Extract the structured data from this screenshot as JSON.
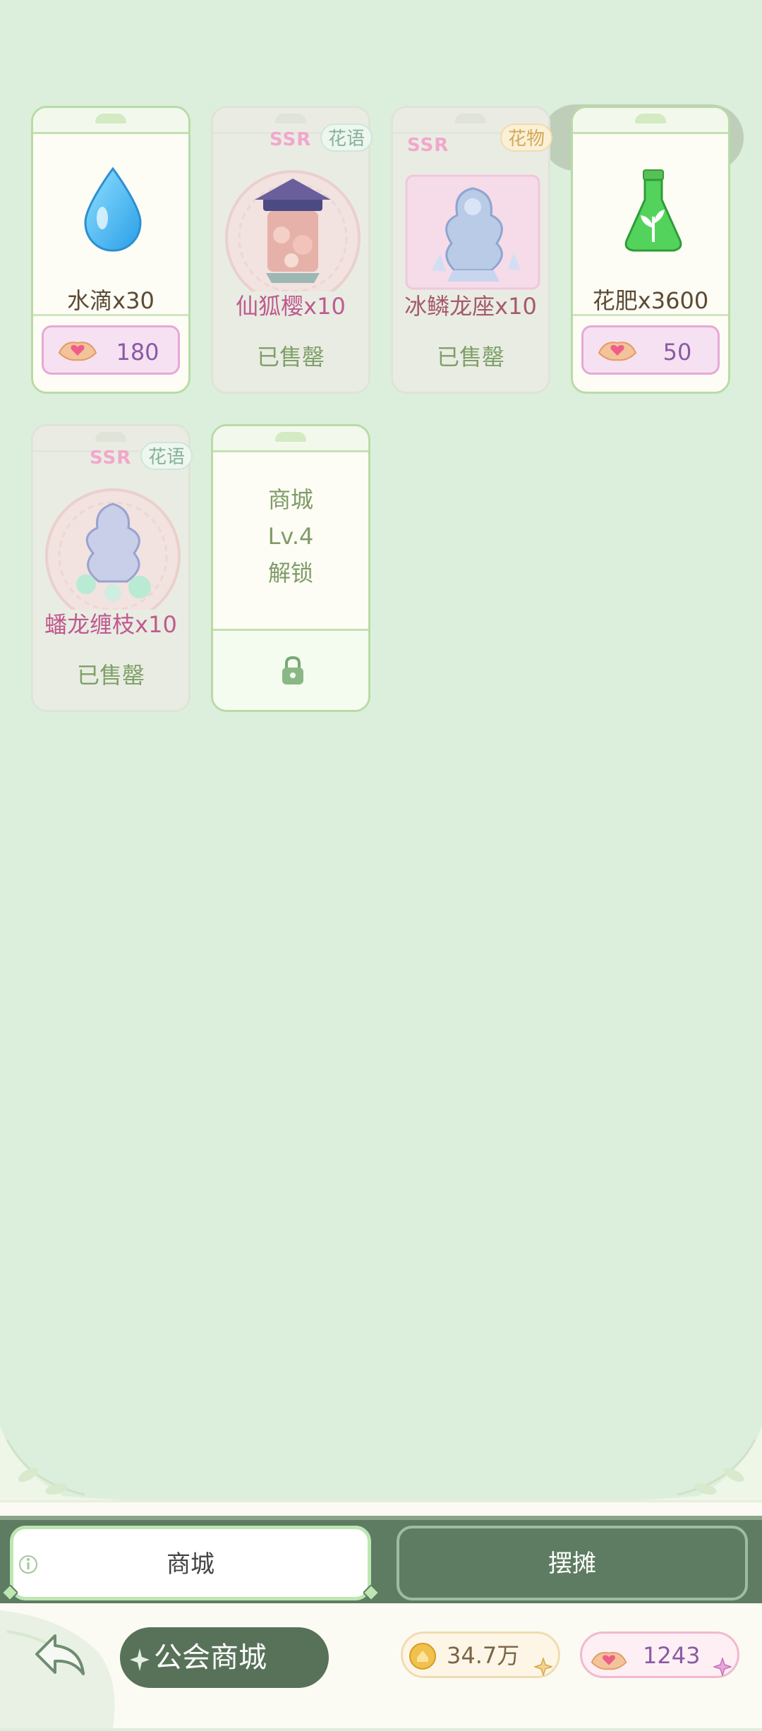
{
  "items": [
    {
      "name": "水滴x30",
      "price": "180",
      "status": ""
    },
    {
      "name": "仙狐樱x10",
      "badge": "SSR",
      "type_tag": "花语",
      "status": "已售罄"
    },
    {
      "name": "冰鳞龙座x10",
      "badge": "SSR",
      "type_tag": "花物",
      "status": "已售罄"
    },
    {
      "name": "花肥x3600",
      "price": "50",
      "status": ""
    },
    {
      "name": "蟠龙缠枝x10",
      "badge": "SSR",
      "type_tag": "花语",
      "status": "已售罄"
    }
  ],
  "locked_card": {
    "line1": "商城",
    "line2": "Lv.4",
    "line3": "解锁"
  },
  "tabs": {
    "shop": "商城",
    "stall": "摆摊"
  },
  "footer": {
    "title": "公会商城",
    "gold": "34.7万",
    "hearts": "1243"
  },
  "colors": {
    "background": "#dcefdc",
    "accent_green": "#587259",
    "price_pink": "#f6e1f2"
  }
}
